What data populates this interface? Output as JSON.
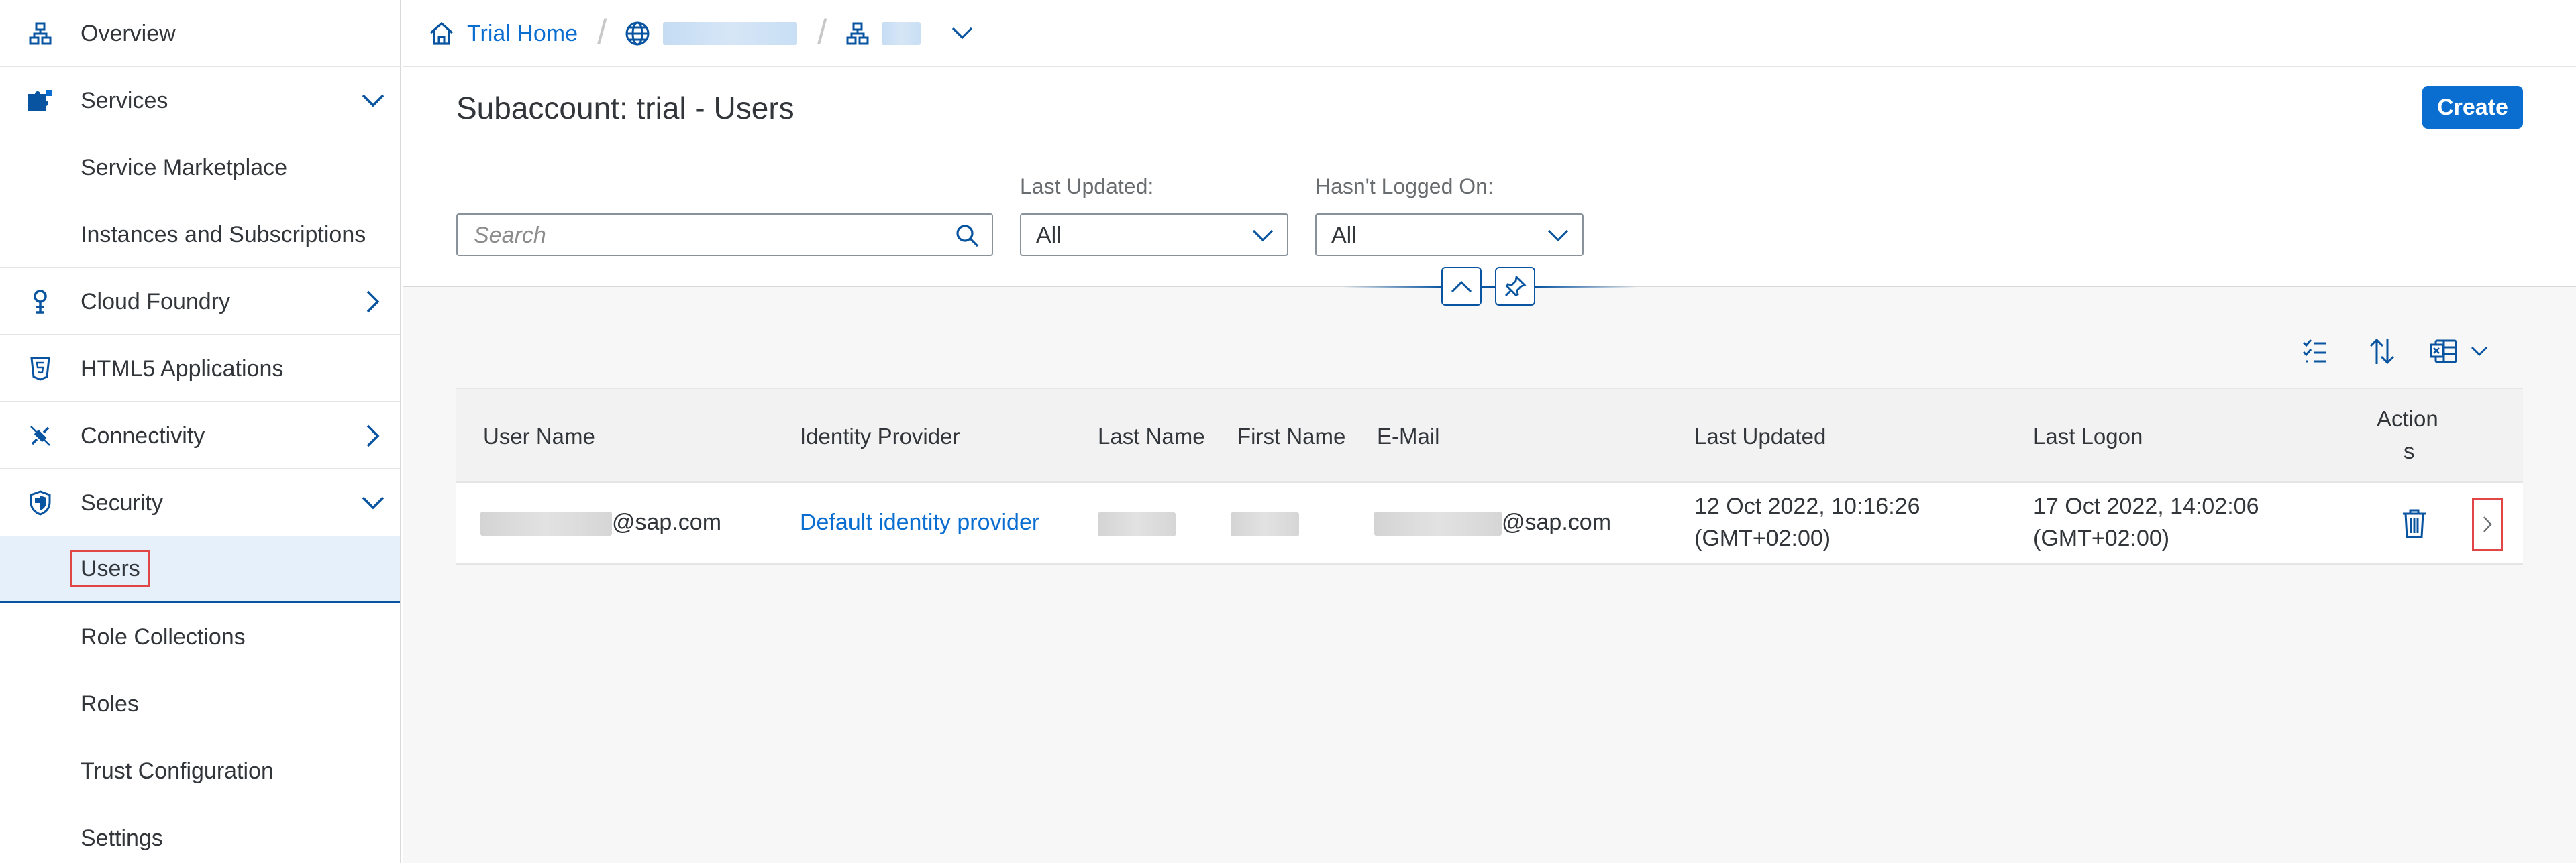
{
  "sidebar": {
    "items": [
      {
        "label": "Overview",
        "icon": "hierarchy-icon"
      },
      {
        "label": "Services",
        "icon": "puzzle-icon"
      },
      {
        "label": "Service Marketplace"
      },
      {
        "label": "Instances and Subscriptions"
      },
      {
        "label": "Cloud Foundry",
        "icon": "cloud-foundry-icon"
      },
      {
        "label": "HTML5 Applications",
        "icon": "html5-icon"
      },
      {
        "label": "Connectivity",
        "icon": "connectivity-icon"
      },
      {
        "label": "Security",
        "icon": "shield-icon"
      },
      {
        "label": "Users"
      },
      {
        "label": "Role Collections"
      },
      {
        "label": "Roles"
      },
      {
        "label": "Trust Configuration"
      },
      {
        "label": "Settings"
      }
    ]
  },
  "breadcrumb": {
    "home_label": "Trial Home"
  },
  "page": {
    "title": "Subaccount: trial - Users",
    "create_label": "Create"
  },
  "filters": {
    "search_placeholder": "Search",
    "last_updated_label": "Last Updated:",
    "last_updated_value": "All",
    "not_logged_label": "Hasn't Logged On:",
    "not_logged_value": "All"
  },
  "table": {
    "headers": {
      "user_name": "User Name",
      "identity_provider": "Identity Provider",
      "last_name": "Last Name",
      "first_name": "First Name",
      "email": "E-Mail",
      "last_updated": "Last Updated",
      "last_logon": "Last Logon",
      "actions_line1": "Action",
      "actions_line2": "s"
    },
    "rows": [
      {
        "user_suffix": "@sap.com",
        "identity_provider": "Default identity provider",
        "email_suffix": "@sap.com",
        "last_updated_1": "12 Oct 2022, 10:16:26",
        "last_updated_2": "(GMT+02:00)",
        "last_logon_1": "17 Oct 2022, 14:02:06",
        "last_logon_2": "(GMT+02:00)"
      }
    ]
  },
  "colors": {
    "accent": "#0a6ed1",
    "selected_bg": "#e5f0fa",
    "highlight_box": "#e04646"
  }
}
